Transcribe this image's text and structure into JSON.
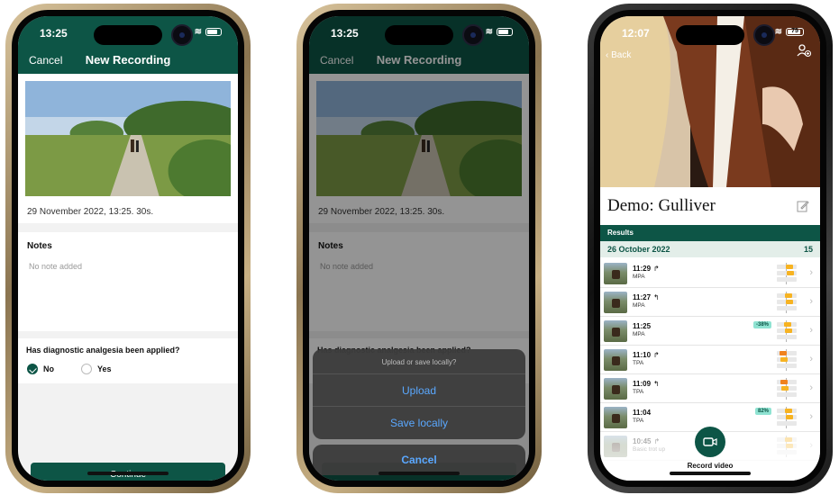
{
  "phone1": {
    "status_time": "13:25",
    "nav": {
      "cancel": "Cancel",
      "title": "New Recording"
    },
    "recording_date": "29 November 2022, 13:25. 30s.",
    "notes": {
      "heading": "Notes",
      "placeholder": "No note added"
    },
    "question": "Has diagnostic analgesia been applied?",
    "options": [
      {
        "label": "No",
        "selected": true
      },
      {
        "label": "Yes",
        "selected": false
      }
    ],
    "continue_label": "Continue"
  },
  "phone2": {
    "status_time": "13:25",
    "nav": {
      "cancel": "Cancel",
      "title": "New Recording"
    },
    "recording_date": "29 November 2022, 13:25. 30s.",
    "notes": {
      "heading": "Notes",
      "placeholder": "No note added"
    },
    "question": "Has diagnostic analgesia been applied?",
    "sheet": {
      "header": "Upload or save locally?",
      "upload": "Upload",
      "save_locally": "Save locally",
      "cancel": "Cancel"
    }
  },
  "phone3": {
    "status_time": "12:07",
    "battery": "75",
    "back_label": "Back",
    "horse_name": "Demo: Gulliver",
    "results_label": "Results",
    "group_date": "26 October 2022",
    "group_count": "15",
    "rows": [
      {
        "time": "11:29",
        "arrow": "↱",
        "type": "MPA",
        "pct": "",
        "marker": "#f7b321",
        "pos": 0.65
      },
      {
        "time": "11:27",
        "arrow": "↰",
        "type": "MPA",
        "pct": "",
        "marker": "#f7b321",
        "pos": 0.6
      },
      {
        "time": "11:25",
        "arrow": "",
        "type": "MPA",
        "pct": "-38%",
        "marker": "#f7b321",
        "pos": 0.55
      },
      {
        "time": "11:10",
        "arrow": "↱",
        "type": "TPA",
        "pct": "",
        "marker": "#f0821e",
        "pos": 0.3
      },
      {
        "time": "11:09",
        "arrow": "↰",
        "type": "TPA",
        "pct": "",
        "marker": "#f0821e",
        "pos": 0.35
      },
      {
        "time": "11:04",
        "arrow": "",
        "type": "TPA",
        "pct": "82%",
        "marker": "#f7b321",
        "pos": 0.6
      },
      {
        "time": "10:45",
        "arrow": "↱",
        "type": "Basic trot up",
        "pct": "",
        "marker": "#f7b321",
        "pos": 0.6
      }
    ],
    "record_label": "Record video",
    "colors": {
      "brand": "#0d5546",
      "accent_teal": "#8fe3d2"
    }
  }
}
